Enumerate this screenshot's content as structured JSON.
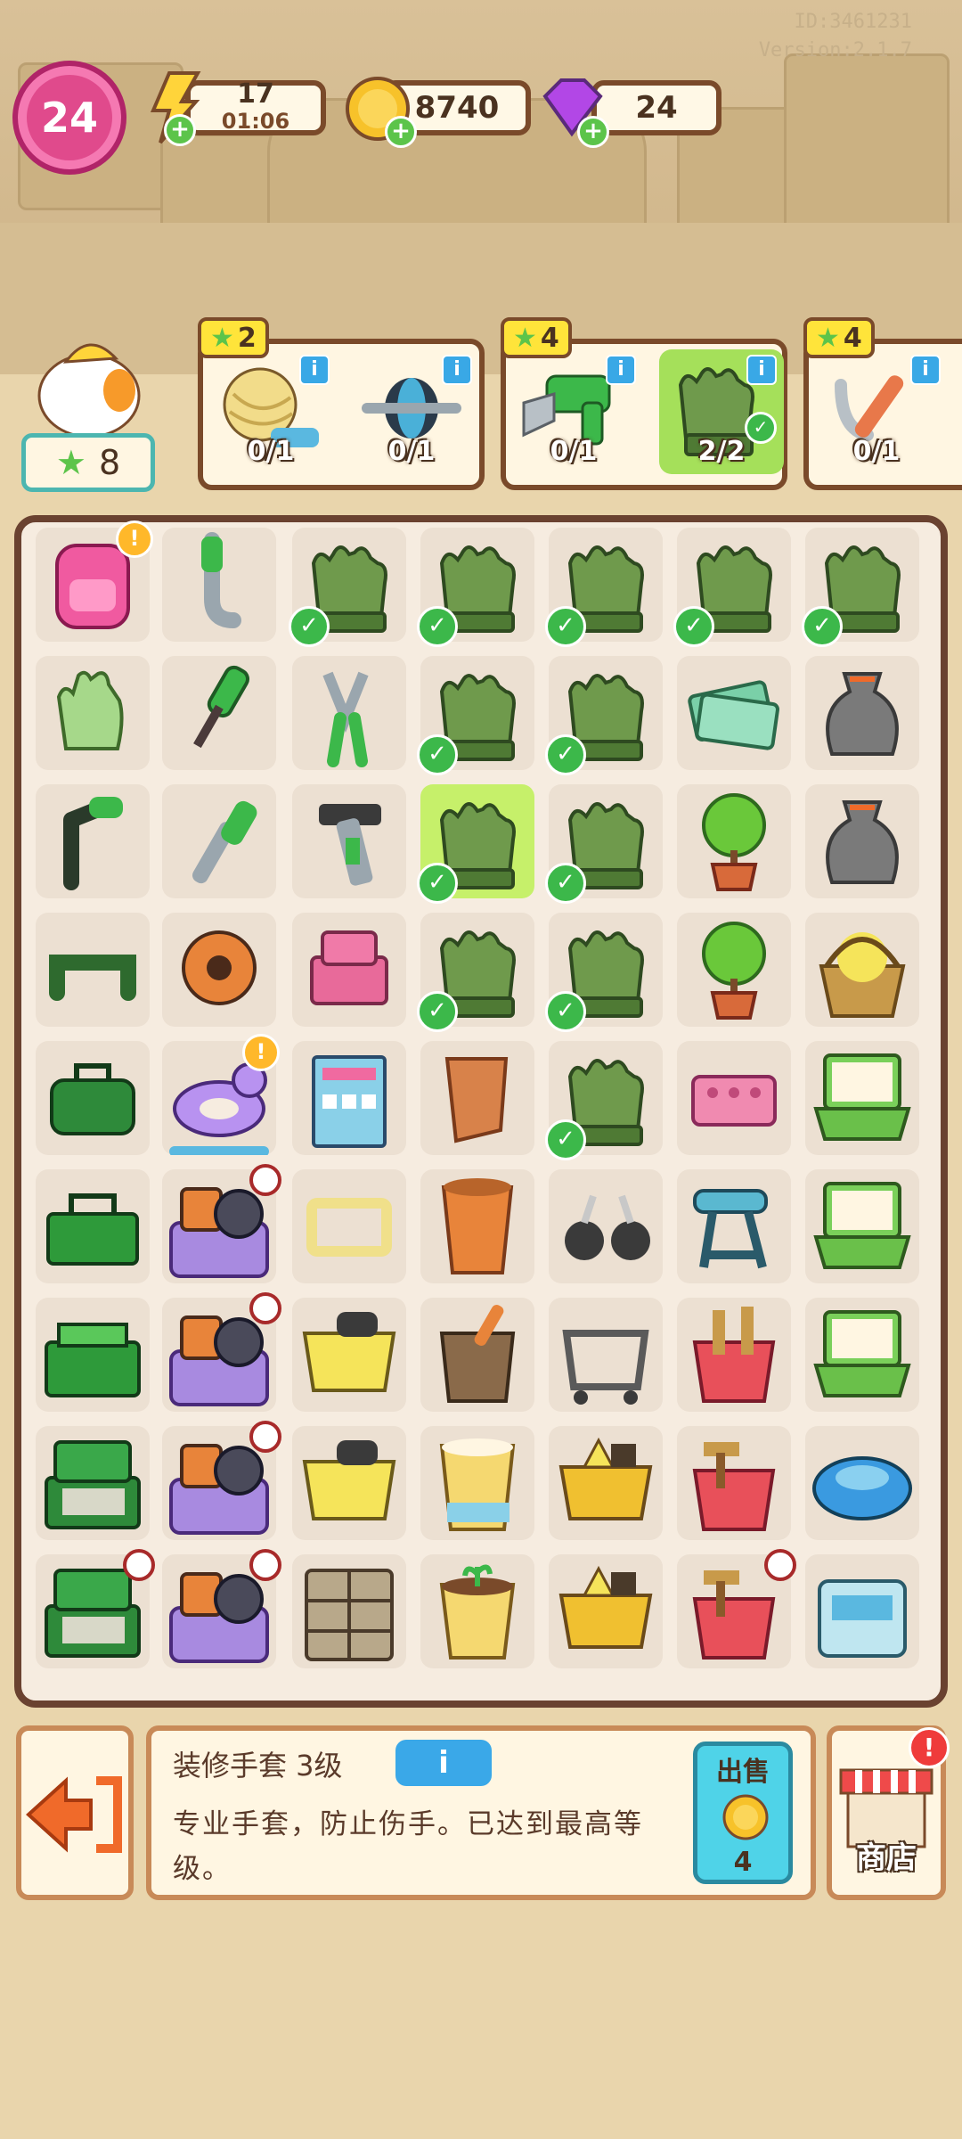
{
  "meta": {
    "id_text": "ID:3461231",
    "version_text": "Version:2.1.7"
  },
  "hud": {
    "level": "24",
    "energy": {
      "value": "17",
      "timer": "01:06"
    },
    "coins": "8740",
    "gems": "24"
  },
  "worker": {
    "stars": "8"
  },
  "orders": [
    {
      "reward": "2",
      "items": [
        {
          "icon": "yarn-ball-icon",
          "count": "0/1"
        },
        {
          "icon": "ab-roller-icon",
          "count": "0/1"
        }
      ]
    },
    {
      "reward": "4",
      "items": [
        {
          "icon": "electric-saw-icon",
          "count": "0/1"
        },
        {
          "icon": "work-gloves-icon",
          "count": "2/2",
          "done": true
        }
      ]
    },
    {
      "reward": "4",
      "items": [
        {
          "icon": "pliers-icon",
          "count": "0/1"
        }
      ]
    }
  ],
  "board": {
    "rows": [
      [
        "pink-backpack",
        "pipe",
        "gloves-check",
        "gloves-check",
        "gloves-check",
        "gloves-check",
        "gloves-check"
      ],
      [
        "light-glove",
        "screwdriver",
        "pliers",
        "gloves-check",
        "gloves-check",
        "money",
        "sack"
      ],
      [
        "hex-key",
        "wrench",
        "pipe-wrench",
        "gloves-selected",
        "gloves-check",
        "potted-tree",
        "sack"
      ],
      [
        "staple",
        "tape-roll",
        "bricks",
        "gloves-check",
        "gloves-check",
        "potted-tree",
        "flower-basket"
      ],
      [
        "green-case",
        "unicorn-float",
        "building",
        "clay-pot",
        "gloves-check",
        "pink-brick",
        "laptop"
      ],
      [
        "green-toolbox",
        "clutter-pile",
        "frame",
        "flower-pot",
        "casters",
        "bench",
        "laptop"
      ],
      [
        "open-toolbox",
        "clutter-pile",
        "cart-dumbbell",
        "mortar",
        "cart-empty",
        "bucket-tools",
        "laptop"
      ],
      [
        "stacked-toolbox",
        "clutter-pile",
        "cart-dumbbell",
        "water-bucket",
        "cart-gold",
        "bucket-hammer",
        "robot-vacuum"
      ],
      [
        "stacked-toolbox-timer",
        "clutter-pile",
        "cabinet",
        "sprout-bucket",
        "cart-gold",
        "bucket-hammer-timer",
        "appliance"
      ]
    ]
  },
  "selected_item": {
    "title": "装修手套 3级",
    "info_label": "i",
    "description": "专业手套，防止伤手。已达到最高等级。",
    "sell_label": "出售",
    "sell_value": "4"
  },
  "shop": {
    "label": "商店",
    "alert": "!"
  },
  "colors": {
    "border": "#7a4a2a",
    "green": "#5cc44a",
    "accent_blue": "#3aa8e8",
    "level_pink": "#e04a8c"
  }
}
